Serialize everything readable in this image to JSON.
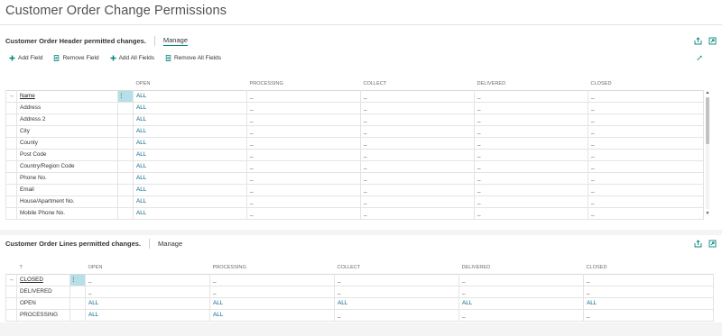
{
  "page": {
    "title": "Customer Order Change Permissions"
  },
  "header_part": {
    "caption": "Customer Order Header permitted changes.",
    "manage_label": "Manage",
    "icons": [
      "share-icon",
      "expand-icon"
    ],
    "actions": [
      {
        "label": "Add Field",
        "icon": "plus-icon"
      },
      {
        "label": "Remove Field",
        "icon": "document-icon"
      },
      {
        "label": "Add All Fields",
        "icon": "plus-icon"
      },
      {
        "label": "Remove All Fields",
        "icon": "document-icon"
      }
    ],
    "columns": [
      "OPEN",
      "PROCESSING",
      "COLLECT",
      "DELIVERED",
      "CLOSED"
    ],
    "rows": [
      {
        "field": "Name",
        "values": [
          "ALL",
          "_",
          "_",
          "_",
          "_"
        ]
      },
      {
        "field": "Address",
        "values": [
          "ALL",
          "_",
          "_",
          "_",
          "_"
        ]
      },
      {
        "field": "Address 2",
        "values": [
          "ALL",
          "_",
          "_",
          "_",
          "_"
        ]
      },
      {
        "field": "City",
        "values": [
          "ALL",
          "_",
          "_",
          "_",
          "_"
        ]
      },
      {
        "field": "County",
        "values": [
          "ALL",
          "_",
          "_",
          "_",
          "_"
        ]
      },
      {
        "field": "Post Code",
        "values": [
          "ALL",
          "_",
          "_",
          "_",
          "_"
        ]
      },
      {
        "field": "Country/Region Code",
        "values": [
          "ALL",
          "_",
          "_",
          "_",
          "_"
        ]
      },
      {
        "field": "Phone No.",
        "values": [
          "ALL",
          "_",
          "_",
          "_",
          "_"
        ]
      },
      {
        "field": "Email",
        "values": [
          "ALL",
          "_",
          "_",
          "_",
          "_"
        ]
      },
      {
        "field": "House/Apartment No.",
        "values": [
          "ALL",
          "_",
          "_",
          "_",
          "_"
        ]
      },
      {
        "field": "Mobile Phone No.",
        "values": [
          "ALL",
          "_",
          "_",
          "_",
          "_"
        ]
      }
    ]
  },
  "lines_part": {
    "caption": "Customer Order Lines permitted changes.",
    "manage_label": "Manage",
    "icons": [
      "share-icon",
      "expand-icon"
    ],
    "first_column": "T",
    "columns": [
      "OPEN",
      "PROCESSING",
      "COLLECT",
      "DELIVERED",
      "CLOSED"
    ],
    "rows": [
      {
        "field": "CLOSED",
        "values": [
          "_",
          "_",
          "_",
          "_",
          "_"
        ]
      },
      {
        "field": "DELIVERED",
        "values": [
          "_",
          "_",
          "_",
          "_",
          "_"
        ]
      },
      {
        "field": "OPEN",
        "values": [
          "ALL",
          "ALL",
          "ALL",
          "ALL",
          "ALL"
        ]
      },
      {
        "field": "PROCESSING",
        "values": [
          "ALL",
          "ALL",
          "_",
          "_",
          "_"
        ]
      }
    ]
  },
  "row_selected_marker": "→",
  "row_menu_glyph": "⋮",
  "colors": {
    "accent": "#00857d",
    "link_value": "#00618a",
    "selected_cell": "#b6e0e8"
  }
}
